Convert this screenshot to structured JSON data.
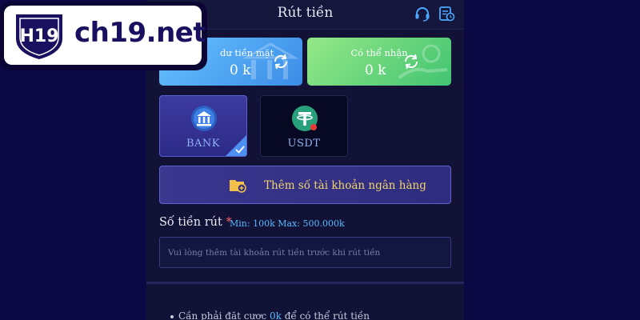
{
  "logo": {
    "brand_text": "ch19.net",
    "shield_text": "H19"
  },
  "header": {
    "title": "Rút tiền",
    "headset_icon": "headset-icon",
    "history_icon": "history-icon"
  },
  "balances": {
    "cash": {
      "label": "dư tiền mặt",
      "amount": "0 k"
    },
    "receivable": {
      "label": "Có thể nhận",
      "amount": "0 k"
    }
  },
  "methods": [
    {
      "label": "BANK",
      "icon": "bank-icon",
      "selected": true
    },
    {
      "label": "USDT",
      "icon": "tether-icon",
      "selected": false
    }
  ],
  "add_bank": {
    "label": "Thêm số tài khoản ngân hàng"
  },
  "amount": {
    "label": "Số tiền rút",
    "required_mark": "*",
    "range": "Min: 100k Max: 500.000k",
    "placeholder": "Vui lòng thêm tài khoản rút tiền trước khi rút tiền"
  },
  "note": {
    "prefix": "Cần phải đặt cược ",
    "highlight": "0k",
    "suffix": " để có thể rút tiền"
  },
  "colors": {
    "accent_blue": "#58b9ff",
    "gold": "#f3d36a",
    "required": "#ff5d5d"
  }
}
